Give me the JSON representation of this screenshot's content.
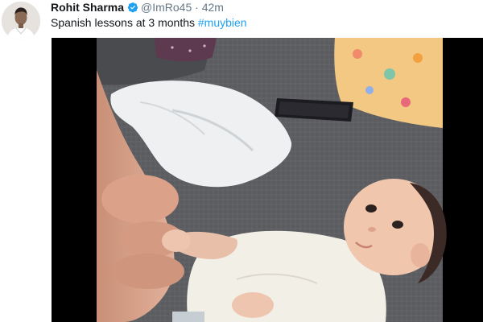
{
  "tweet": {
    "display_name": "Rohit Sharma",
    "handle": "@ImRo45",
    "separator": "·",
    "time": "42m",
    "text": "Spanish lessons at 3 months ",
    "hashtag": "#muybien",
    "verified": true
  },
  "colors": {
    "hashtag": "#1da1f2",
    "meta": "#657786",
    "verified_badge": "#1da1f2"
  },
  "icons": {
    "verified": "verified-badge-icon"
  }
}
